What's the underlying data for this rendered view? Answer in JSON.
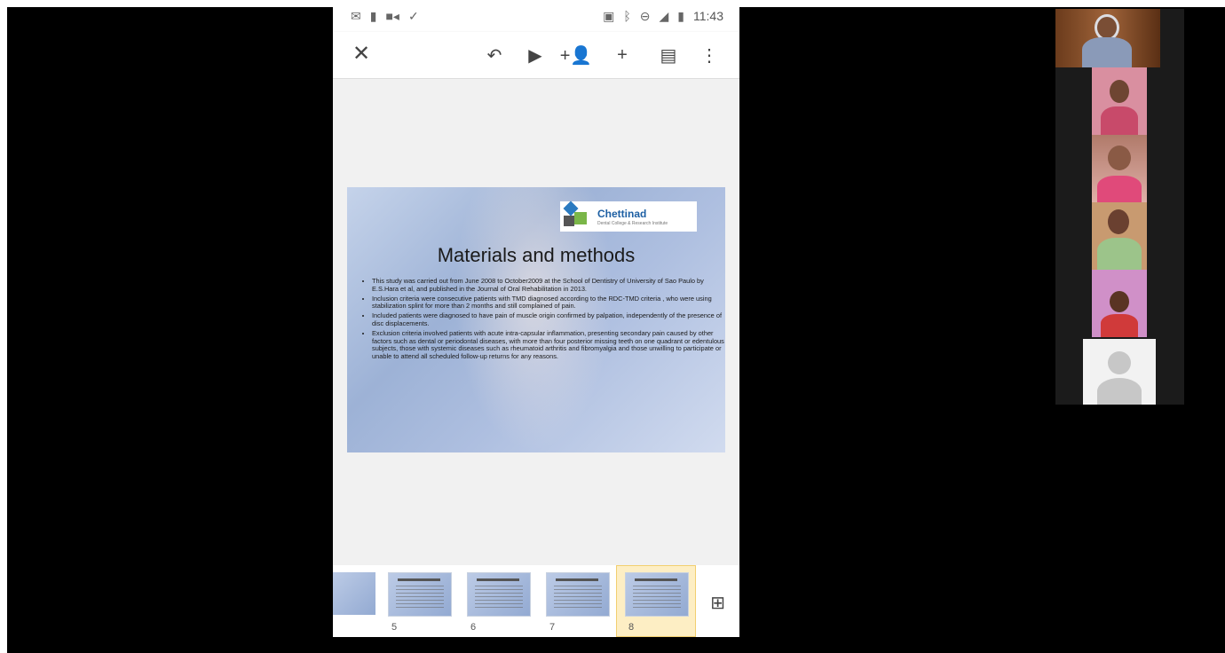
{
  "statusbar": {
    "time": "11:43",
    "left_icons": [
      "gmail-icon",
      "person-icon",
      "video-icon",
      "download-done-icon"
    ],
    "right_icons": [
      "cast-icon",
      "bluetooth-icon",
      "minus-circle-icon",
      "signal-icon",
      "battery-icon"
    ]
  },
  "toolbar": {
    "buttons": [
      "close-icon",
      "undo-icon",
      "present-icon",
      "add-person-icon",
      "add-icon",
      "comment-icon",
      "more-icon"
    ]
  },
  "slide": {
    "logo_name": "Chettinad",
    "logo_sub": "Dental College & Research Institute",
    "title": "Materials and methods",
    "bullets": [
      "This study was carried out from June 2008 to October2009 at the School of Dentistry of University of Sao Paulo by E.S.Hara et al, and published in the Journal of Oral Rehabilitation in 2013.",
      " Inclusion criteria were consecutive patients with TMD diagnosed according to the RDC-TMD criteria , who were using stabilization splint for more than 2 months and still complained of pain.",
      "Included patients were diagnosed to have pain of muscle origin confirmed by palpation, independently of the presence of disc displacements.",
      "Exclusion criteria involved patients with acute intra-capsular inflammation, presenting secondary pain caused by other factors such as dental or periodontal diseases, with more than four posterior missing teeth on one quadrant or edentulous subjects, those with systemic diseases such as rheumatoid arthritis and fibromyalgia and those unwilling to participate or unable to attend all scheduled follow-up returns for any reasons."
    ]
  },
  "thumbnails": [
    {
      "num": "5"
    },
    {
      "num": "6"
    },
    {
      "num": "7"
    },
    {
      "num": "8",
      "selected": true
    }
  ],
  "colors": {
    "accent": "#1d5fa3",
    "selected_thumb": "#fdeec4"
  }
}
